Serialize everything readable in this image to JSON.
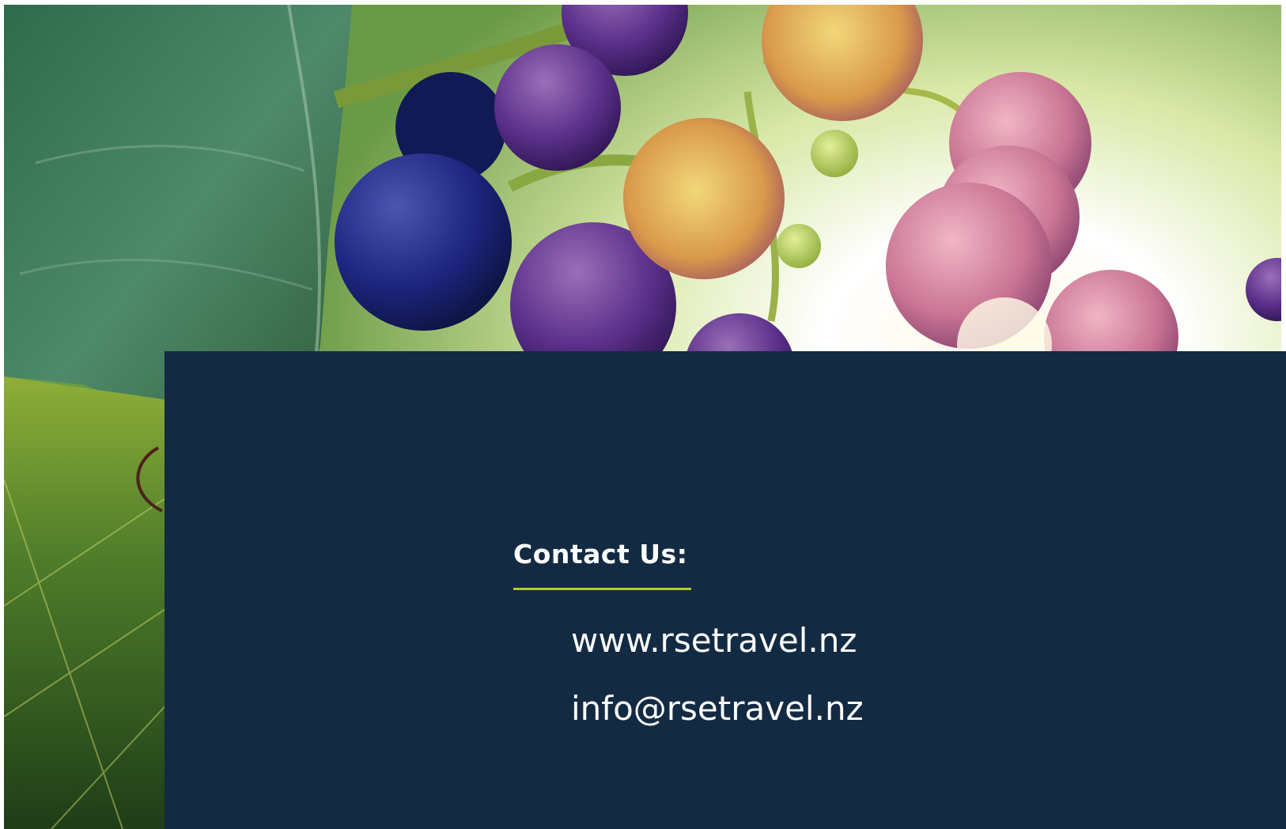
{
  "contact": {
    "heading": "Contact Us:",
    "website": "www.rsetravel.nz",
    "email": "info@rsetravel.nz"
  },
  "colors": {
    "panel": "#132a43",
    "accent": "#b5c832",
    "text": "#ffffff"
  }
}
